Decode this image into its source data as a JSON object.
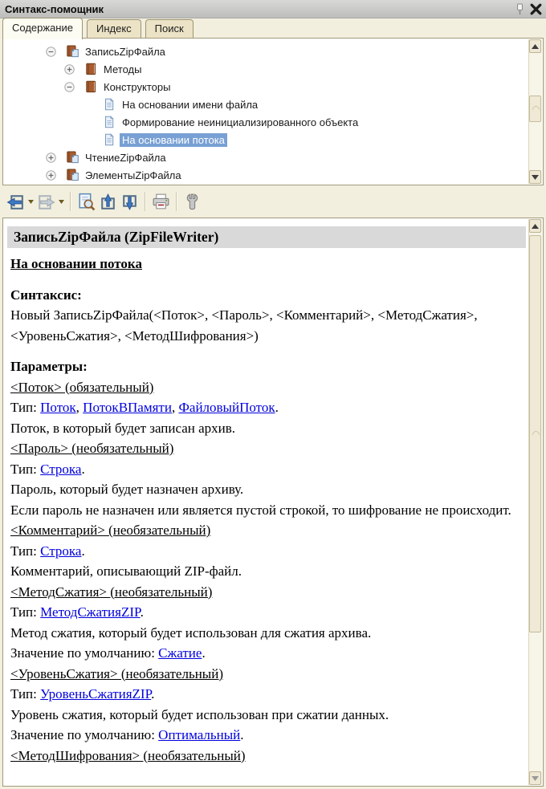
{
  "window": {
    "title": "Синтакс-помощник"
  },
  "titlebar_icons": [
    "pin-icon",
    "close-icon"
  ],
  "tabs": [
    {
      "name": "tab-contents",
      "label": "Содержание",
      "active": true
    },
    {
      "name": "tab-index",
      "label": "Индекс",
      "active": false
    },
    {
      "name": "tab-search",
      "label": "Поиск",
      "active": false
    }
  ],
  "tree": {
    "items": [
      {
        "label": "ЗаписьZipФайла",
        "level": 0,
        "expander": "minus",
        "icon": "book-with-page-icon",
        "selected": false
      },
      {
        "label": "Методы",
        "level": 1,
        "expander": "plus",
        "icon": "book-icon",
        "selected": false
      },
      {
        "label": "Конструкторы",
        "level": 1,
        "expander": "minus",
        "icon": "book-icon",
        "selected": false
      },
      {
        "label": "На основании имени файла",
        "level": 2,
        "expander": "none",
        "icon": "document-icon",
        "selected": false
      },
      {
        "label": "Формирование неинициализированного объекта",
        "level": 2,
        "expander": "none",
        "icon": "document-icon",
        "selected": false
      },
      {
        "label": "На основании потока",
        "level": 2,
        "expander": "none",
        "icon": "document-icon",
        "selected": true
      },
      {
        "label": "ЧтениеZipФайла",
        "level": 0,
        "expander": "plus",
        "icon": "book-with-page-icon",
        "selected": false
      },
      {
        "label": "ЭлементыZipФайла",
        "level": 0,
        "expander": "plus",
        "icon": "book-with-page-icon",
        "selected": false
      }
    ]
  },
  "toolbar": {
    "buttons": [
      {
        "name": "back-button",
        "icon": "back-arrow-icon",
        "dropdown": true,
        "disabled": false
      },
      {
        "name": "forward-button",
        "icon": "forward-arrow-icon",
        "dropdown": true,
        "disabled": true
      },
      {
        "sep": true
      },
      {
        "name": "find-in-contents-button",
        "icon": "find-page-icon"
      },
      {
        "name": "previous-topic-button",
        "icon": "arrow-up-icon"
      },
      {
        "name": "next-topic-button",
        "icon": "arrow-down-icon"
      },
      {
        "sep": true
      },
      {
        "name": "print-button",
        "icon": "printer-icon"
      },
      {
        "sep": true
      },
      {
        "name": "settings-button",
        "icon": "wrench-icon"
      }
    ]
  },
  "content": {
    "header": "ЗаписьZipФайла (ZipFileWriter)",
    "paragraphs": [
      {
        "type": "doc-title",
        "parts": [
          {
            "text": "На основании потока"
          }
        ]
      },
      {
        "type": "section-head",
        "parts": [
          {
            "text": "Синтаксис:"
          }
        ]
      },
      {
        "type": "text",
        "parts": [
          {
            "text": "Новый ЗаписьZipФайла(<Поток>, <Пароль>, <Комментарий>, <МетодСжатия>, <УровеньСжатия>, <МетодШифрования>)"
          }
        ]
      },
      {
        "type": "section-head",
        "parts": [
          {
            "text": "Параметры:"
          }
        ]
      },
      {
        "type": "param-head",
        "parts": [
          {
            "text": "<Поток> (обязательный)"
          }
        ]
      },
      {
        "type": "text",
        "parts": [
          {
            "text": "Тип: "
          },
          {
            "text": "Поток",
            "link": true
          },
          {
            "text": ", "
          },
          {
            "text": "ПотокВПамяти",
            "link": true
          },
          {
            "text": ", "
          },
          {
            "text": "ФайловыйПоток",
            "link": true
          },
          {
            "text": "."
          }
        ]
      },
      {
        "type": "text",
        "parts": [
          {
            "text": "Поток, в который будет записан архив."
          }
        ]
      },
      {
        "type": "param-head",
        "parts": [
          {
            "text": "<Пароль> (необязательный)"
          }
        ]
      },
      {
        "type": "text",
        "parts": [
          {
            "text": "Тип: "
          },
          {
            "text": "Строка",
            "link": true
          },
          {
            "text": "."
          }
        ]
      },
      {
        "type": "text",
        "parts": [
          {
            "text": "Пароль, который будет назначен архиву."
          }
        ]
      },
      {
        "type": "text",
        "parts": [
          {
            "text": "Если пароль не назначен или является пустой строкой, то шифрование не происходит."
          }
        ]
      },
      {
        "type": "param-head",
        "parts": [
          {
            "text": "<Комментарий> (необязательный)"
          }
        ]
      },
      {
        "type": "text",
        "parts": [
          {
            "text": "Тип: "
          },
          {
            "text": "Строка",
            "link": true
          },
          {
            "text": "."
          }
        ]
      },
      {
        "type": "text",
        "parts": [
          {
            "text": "Комментарий, описывающий ZIP-файл."
          }
        ]
      },
      {
        "type": "param-head",
        "parts": [
          {
            "text": "<МетодСжатия> (необязательный)"
          }
        ]
      },
      {
        "type": "text",
        "parts": [
          {
            "text": "Тип: "
          },
          {
            "text": "МетодСжатияZIP",
            "link": true
          },
          {
            "text": "."
          }
        ]
      },
      {
        "type": "text",
        "parts": [
          {
            "text": "Метод сжатия, который будет использован для сжатия архива."
          }
        ]
      },
      {
        "type": "text",
        "parts": [
          {
            "text": "Значение по умолчанию: "
          },
          {
            "text": "Сжатие",
            "link": true
          },
          {
            "text": "."
          }
        ]
      },
      {
        "type": "param-head",
        "parts": [
          {
            "text": "<УровеньСжатия> (необязательный)"
          }
        ]
      },
      {
        "type": "text",
        "parts": [
          {
            "text": "Тип: "
          },
          {
            "text": "УровеньСжатияZIP",
            "link": true
          },
          {
            "text": "."
          }
        ]
      },
      {
        "type": "text",
        "parts": [
          {
            "text": "Уровень сжатия, который будет использован при сжатии данных."
          }
        ]
      },
      {
        "type": "text",
        "parts": [
          {
            "text": "Значение по умолчанию: "
          },
          {
            "text": "Оптимальный",
            "link": true
          },
          {
            "text": "."
          }
        ]
      },
      {
        "type": "param-head",
        "parts": [
          {
            "text": "<МетодШифрования> (необязательный)"
          }
        ]
      }
    ]
  },
  "colors": {
    "background": "#f2efde",
    "selection": "#78a0d4",
    "link": "#0000dd",
    "header_bar": "#d9d9d9",
    "book_icon": "#a85c30"
  }
}
